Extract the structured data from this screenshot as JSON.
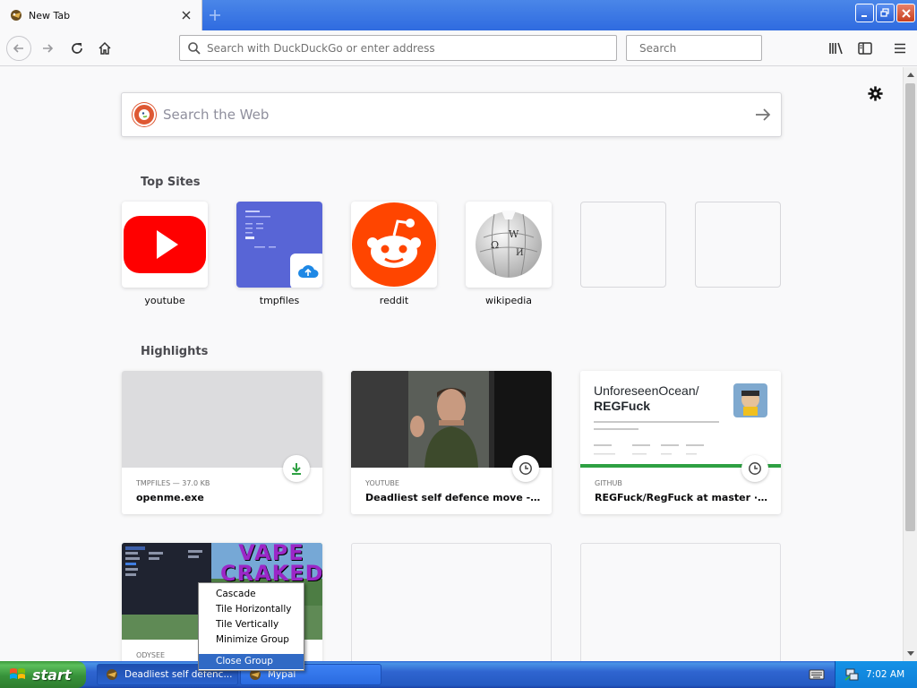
{
  "tab": {
    "title": "New Tab"
  },
  "toolbar": {
    "url_placeholder": "Search with DuckDuckGo or enter address",
    "search_placeholder": "Search"
  },
  "newtab": {
    "websearch_placeholder": "Search the Web",
    "top_sites_title": "Top Sites",
    "highlights_title": "Highlights",
    "top_sites": [
      {
        "label": "youtube",
        "icon": "youtube-logo"
      },
      {
        "label": "tmpfiles",
        "icon": "tmpfiles-screenshot"
      },
      {
        "label": "reddit",
        "icon": "reddit-logo"
      },
      {
        "label": "wikipedia",
        "icon": "wikipedia-logo"
      }
    ],
    "highlights": [
      {
        "context": "TMPFILES — 37.0 KB",
        "title": "openme.exe",
        "badge": "download-icon"
      },
      {
        "context": "YOUTUBE",
        "title": "Deadliest self defence move - Y...",
        "badge": "clock-icon"
      },
      {
        "context": "GITHUB",
        "title": "REGFuck/RegFuck at master · U...",
        "badge": "clock-icon",
        "preview": {
          "repo_owner": "UnforeseenOcean/",
          "repo_name": "REGFuck"
        }
      },
      {
        "context": "ODYSEE",
        "title": "",
        "badge": "",
        "preview": {
          "banner": "VAPE CRAKED"
        }
      }
    ]
  },
  "context_menu": {
    "items": [
      "Cascade",
      "Tile Horizontally",
      "Tile Vertically",
      "Minimize Group"
    ],
    "close_group": "Close Group"
  },
  "taskbar": {
    "start_label": "start",
    "tasks": [
      {
        "label": "Deadliest self defenc..."
      },
      {
        "label": "Mypal"
      }
    ],
    "clock": "7:02 AM"
  },
  "colors": {
    "youtube_red": "#ff0000",
    "reddit_orange": "#ff4500",
    "tmpfiles_blue": "#5865d6",
    "download_green": "#2ea043",
    "menu_highlight": "#316ac5"
  }
}
